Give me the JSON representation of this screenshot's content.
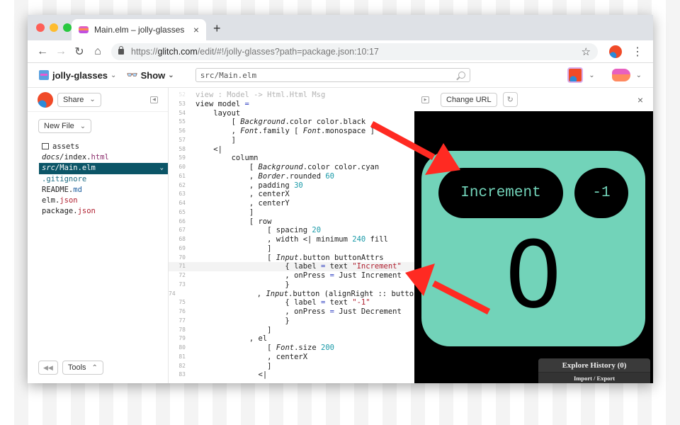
{
  "browser": {
    "tab_title": "Main.elm – jolly-glasses",
    "tab_close": "×",
    "new_tab": "+",
    "back": "←",
    "forward": "→",
    "reload": "↻",
    "home": "⌂",
    "url_scheme": "https://",
    "url_host": "glitch.com",
    "url_path": "/edit/#!/jolly-glasses?path=package.json:10:17",
    "star": "☆",
    "menu": "⋮",
    "traffic_colors": [
      "#fe5f57",
      "#febc2e",
      "#28c840"
    ]
  },
  "appbar": {
    "project_name": "jolly-glasses",
    "caret": "⌄",
    "show_icon": "👓",
    "show_label": "Show",
    "search_value": "src/Main.elm"
  },
  "sidebar": {
    "share_label": "Share",
    "new_file_label": "New File",
    "tools_label": "Tools",
    "rewind_icon": "◀◀",
    "files": [
      {
        "name": "assets",
        "type": "folder"
      },
      {
        "dir": "docs/",
        "base": "index.",
        "ext": "html",
        "extclass": "ext-html"
      },
      {
        "dir": "src/",
        "base": "Main.elm",
        "ext": "",
        "active": true
      },
      {
        "dot": ".gitignore"
      },
      {
        "base": "README.",
        "ext": "md",
        "extclass": "ext-md"
      },
      {
        "base": "elm.",
        "ext": "json",
        "extclass": "ext-json"
      },
      {
        "base": "package.",
        "ext": "json",
        "extclass": "ext-json"
      }
    ]
  },
  "editor": {
    "highlighted_line": 71,
    "lines": [
      {
        "n": "52",
        "segs": [
          [
            "",
            "view : Model -> Html.Html Msg"
          ]
        ]
      },
      {
        "n": "53",
        "segs": [
          [
            "",
            "view model "
          ],
          [
            "op",
            "="
          ]
        ]
      },
      {
        "n": "54",
        "segs": [
          [
            "",
            "    layout"
          ]
        ]
      },
      {
        "n": "55",
        "segs": [
          [
            "",
            "        [ "
          ],
          [
            "it",
            "Background"
          ],
          [
            "",
            ".color color.black"
          ]
        ]
      },
      {
        "n": "56",
        "segs": [
          [
            "",
            "        , "
          ],
          [
            "it",
            "Font"
          ],
          [
            "",
            ".family [ "
          ],
          [
            "it",
            "Font"
          ],
          [
            "",
            ".monospace ]"
          ]
        ]
      },
      {
        "n": "57",
        "segs": [
          [
            "",
            "        ]"
          ]
        ]
      },
      {
        "n": "58",
        "segs": [
          [
            "",
            "    <|"
          ]
        ]
      },
      {
        "n": "59",
        "segs": [
          [
            "",
            "        column"
          ]
        ]
      },
      {
        "n": "60",
        "segs": [
          [
            "",
            "            [ "
          ],
          [
            "it",
            "Background"
          ],
          [
            "",
            ".color color.cyan"
          ]
        ]
      },
      {
        "n": "61",
        "segs": [
          [
            "",
            "            , "
          ],
          [
            "it",
            "Border"
          ],
          [
            "",
            ".rounded "
          ],
          [
            "num",
            "60"
          ]
        ]
      },
      {
        "n": "62",
        "segs": [
          [
            "",
            "            , padding "
          ],
          [
            "num",
            "30"
          ]
        ]
      },
      {
        "n": "63",
        "segs": [
          [
            "",
            "            , centerX"
          ]
        ]
      },
      {
        "n": "64",
        "segs": [
          [
            "",
            "            , centerY"
          ]
        ]
      },
      {
        "n": "65",
        "segs": [
          [
            "",
            "            ]"
          ]
        ]
      },
      {
        "n": "66",
        "segs": [
          [
            "",
            "            [ row"
          ]
        ]
      },
      {
        "n": "67",
        "segs": [
          [
            "",
            "                [ spacing "
          ],
          [
            "num",
            "20"
          ]
        ]
      },
      {
        "n": "68",
        "segs": [
          [
            "",
            "                , width <| minimum "
          ],
          [
            "num",
            "240"
          ],
          [
            "",
            " fill"
          ]
        ]
      },
      {
        "n": "69",
        "segs": [
          [
            "",
            "                ]"
          ]
        ]
      },
      {
        "n": "70",
        "segs": [
          [
            "",
            "                [ "
          ],
          [
            "it",
            "Input"
          ],
          [
            "",
            ".button buttonAttrs"
          ]
        ]
      },
      {
        "n": "71",
        "segs": [
          [
            "",
            "                    { label "
          ],
          [
            "op",
            "="
          ],
          [
            "",
            " text "
          ],
          [
            "str",
            "\"Increment\""
          ]
        ]
      },
      {
        "n": "72",
        "segs": [
          [
            "",
            "                    , onPress "
          ],
          [
            "op",
            "="
          ],
          [
            "",
            " Just Increment"
          ]
        ]
      },
      {
        "n": "73",
        "segs": [
          [
            "",
            "                    }"
          ]
        ]
      },
      {
        "n": "74",
        "segs": [
          [
            "",
            "                , "
          ],
          [
            "it",
            "Input"
          ],
          [
            "",
            ".button (alignRight :: buttonAttrs)"
          ]
        ]
      },
      {
        "n": "75",
        "segs": [
          [
            "",
            "                    { label "
          ],
          [
            "op",
            "="
          ],
          [
            "",
            " text "
          ],
          [
            "str",
            "\"-1\""
          ]
        ]
      },
      {
        "n": "76",
        "segs": [
          [
            "",
            "                    , onPress "
          ],
          [
            "op",
            "="
          ],
          [
            "",
            " Just Decrement"
          ]
        ]
      },
      {
        "n": "77",
        "segs": [
          [
            "",
            "                    }"
          ]
        ]
      },
      {
        "n": "78",
        "segs": [
          [
            "",
            "                ]"
          ]
        ]
      },
      {
        "n": "79",
        "segs": [
          [
            "",
            "            , el"
          ]
        ]
      },
      {
        "n": "80",
        "segs": [
          [
            "",
            "                [ "
          ],
          [
            "it",
            "Font"
          ],
          [
            "",
            ".size "
          ],
          [
            "num",
            "200"
          ]
        ]
      },
      {
        "n": "81",
        "segs": [
          [
            "",
            "                , centerX"
          ]
        ]
      },
      {
        "n": "82",
        "segs": [
          [
            "",
            "                ]"
          ]
        ]
      },
      {
        "n": "83",
        "segs": [
          [
            "",
            "              <|"
          ]
        ]
      }
    ]
  },
  "preview": {
    "change_url_label": "Change URL",
    "refresh_icon": "↻",
    "close_icon": "×",
    "increment_label": "Increment",
    "decrement_label": "-1",
    "counter_value": "0",
    "history_title": "Explore History (0)",
    "history_sub": "Import / Export",
    "cyan": "#72d3b9"
  },
  "annotations": {
    "arrow_color": "#ff2a22"
  }
}
